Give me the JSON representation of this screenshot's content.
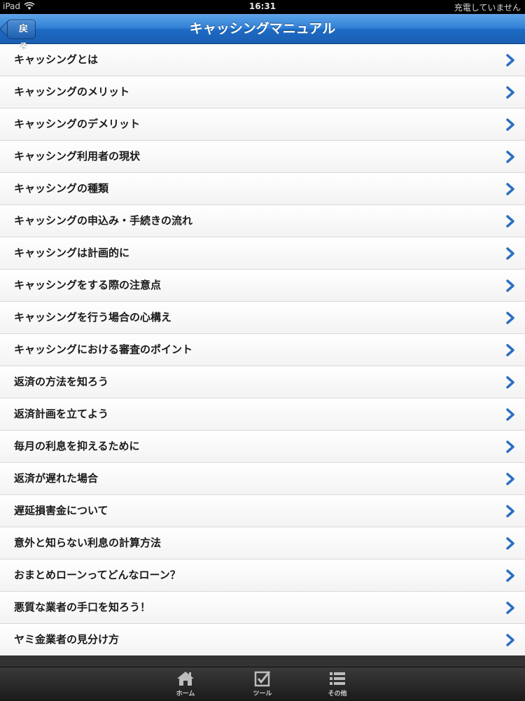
{
  "status_bar": {
    "device": "iPad",
    "time": "16:31",
    "charging": "充電していません"
  },
  "nav": {
    "back_label": "戻る",
    "title": "キャッシングマニュアル"
  },
  "list": {
    "items": [
      {
        "label": "キャッシングとは"
      },
      {
        "label": "キャッシングのメリット"
      },
      {
        "label": "キャッシングのデメリット"
      },
      {
        "label": "キャッシング利用者の現状"
      },
      {
        "label": "キャッシングの種類"
      },
      {
        "label": "キャッシングの申込み・手続きの流れ"
      },
      {
        "label": "キャッシングは計画的に"
      },
      {
        "label": "キャッシングをする際の注意点"
      },
      {
        "label": "キャッシングを行う場合の心構え"
      },
      {
        "label": "キャッシングにおける審査のポイント"
      },
      {
        "label": "返済の方法を知ろう"
      },
      {
        "label": "返済計画を立てよう"
      },
      {
        "label": "毎月の利息を抑えるために"
      },
      {
        "label": "返済が遅れた場合"
      },
      {
        "label": "遅延損害金について"
      },
      {
        "label": "意外と知らない利息の計算方法"
      },
      {
        "label": "おまとめローンってどんなローン？"
      },
      {
        "label": "悪質な業者の手口を知ろう！"
      },
      {
        "label": "ヤミ金業者の見分け方"
      }
    ]
  },
  "tabbar": {
    "tabs": [
      {
        "label": "ホーム",
        "icon": "home-icon"
      },
      {
        "label": "ツール",
        "icon": "checkbox-icon"
      },
      {
        "label": "その他",
        "icon": "list-icon"
      }
    ]
  },
  "colors": {
    "nav_blue": "#2f7fd6",
    "chevron_blue": "#2b6fc2",
    "list_bg": "#f2f2f2"
  }
}
